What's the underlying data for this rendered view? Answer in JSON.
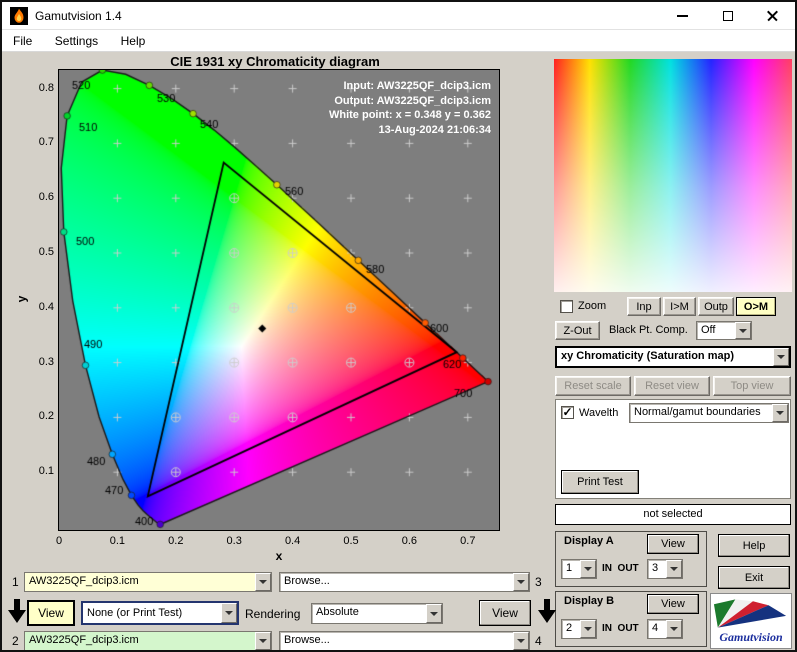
{
  "window": {
    "title": "Gamutvision 1.4",
    "menu": [
      "File",
      "Settings",
      "Help"
    ]
  },
  "icons": {
    "checkmark": "✓"
  },
  "chart": {
    "title": "CIE 1931 xy Chromaticity diagram",
    "xlabel": "x",
    "ylabel": "y",
    "overlay_lines": [
      "Input:  AW3225QF_dcip3.icm",
      "Output: AW3225QF_dcip3.icm",
      "White point:  x = 0.348  y = 0.362",
      "13-Aug-2024 21:06:34"
    ]
  },
  "chart_data": {
    "type": "scatter",
    "title": "CIE 1931 xy Chromaticity diagram",
    "xlabel": "x",
    "ylabel": "y",
    "xlim": [
      0,
      0.7534
    ],
    "ylim": [
      -0.0055,
      0.8339
    ],
    "x_ticks": [
      0,
      0.1,
      0.2,
      0.3,
      0.4,
      0.5,
      0.6,
      0.7
    ],
    "y_ticks": [
      0.1,
      0.2,
      0.3,
      0.4,
      0.5,
      0.6,
      0.7,
      0.8
    ],
    "grid_step": 0.1,
    "plot_background": "#7e7e7e",
    "white_point": {
      "x": 0.348,
      "y": 0.362
    },
    "gamut_triangle": [
      [
        0.681,
        0.319
      ],
      [
        0.282,
        0.665
      ],
      [
        0.152,
        0.056
      ]
    ],
    "spectral_locus": [
      [
        380,
        0.1741,
        0.005
      ],
      [
        390,
        0.1738,
        0.0049
      ],
      [
        400,
        0.1733,
        0.0048
      ],
      [
        410,
        0.1726,
        0.0048
      ],
      [
        420,
        0.1714,
        0.0051
      ],
      [
        430,
        0.1689,
        0.0069
      ],
      [
        435,
        0.1669,
        0.0086
      ],
      [
        440,
        0.1644,
        0.0109
      ],
      [
        445,
        0.1611,
        0.0138
      ],
      [
        450,
        0.1566,
        0.0177
      ],
      [
        455,
        0.151,
        0.0227
      ],
      [
        460,
        0.144,
        0.0297
      ],
      [
        465,
        0.1355,
        0.0399
      ],
      [
        470,
        0.1241,
        0.0578
      ],
      [
        475,
        0.1096,
        0.0868
      ],
      [
        480,
        0.0913,
        0.1327
      ],
      [
        485,
        0.0687,
        0.2007
      ],
      [
        490,
        0.0454,
        0.295
      ],
      [
        495,
        0.0235,
        0.4127
      ],
      [
        500,
        0.0082,
        0.5384
      ],
      [
        505,
        0.0039,
        0.6548
      ],
      [
        510,
        0.0139,
        0.7502
      ],
      [
        515,
        0.0389,
        0.812
      ],
      [
        520,
        0.0743,
        0.8338
      ],
      [
        525,
        0.1142,
        0.8262
      ],
      [
        530,
        0.1547,
        0.8059
      ],
      [
        535,
        0.1929,
        0.7816
      ],
      [
        540,
        0.2296,
        0.7543
      ],
      [
        545,
        0.2658,
        0.7243
      ],
      [
        550,
        0.3016,
        0.6923
      ],
      [
        555,
        0.3373,
        0.6589
      ],
      [
        560,
        0.3731,
        0.6245
      ],
      [
        565,
        0.4087,
        0.5896
      ],
      [
        570,
        0.4441,
        0.5547
      ],
      [
        575,
        0.4788,
        0.5202
      ],
      [
        580,
        0.5125,
        0.4866
      ],
      [
        585,
        0.5448,
        0.4544
      ],
      [
        590,
        0.5752,
        0.4242
      ],
      [
        595,
        0.6029,
        0.3965
      ],
      [
        600,
        0.627,
        0.3725
      ],
      [
        605,
        0.6482,
        0.3514
      ],
      [
        610,
        0.6658,
        0.334
      ],
      [
        615,
        0.6801,
        0.3197
      ],
      [
        620,
        0.6915,
        0.3083
      ],
      [
        630,
        0.7079,
        0.292
      ],
      [
        640,
        0.719,
        0.2809
      ],
      [
        650,
        0.726,
        0.274
      ],
      [
        660,
        0.73,
        0.27
      ],
      [
        680,
        0.7334,
        0.2666
      ],
      [
        700,
        0.7347,
        0.2653
      ]
    ],
    "wavelength_marks": [
      {
        "wl": "520",
        "x": 0.0743,
        "y": 0.8338,
        "color": "#2bd800",
        "lx": 13,
        "ly": 16
      },
      {
        "wl": "530",
        "x": 0.1547,
        "y": 0.8059,
        "color": "#66dc00",
        "lx": 98,
        "ly": 29
      },
      {
        "wl": "510",
        "x": 0.0139,
        "y": 0.7502,
        "color": "#00d42a",
        "lx": 20,
        "ly": 58
      },
      {
        "wl": "540",
        "x": 0.2296,
        "y": 0.7543,
        "color": "#9fe000",
        "lx": 141,
        "ly": 55
      },
      {
        "wl": "560",
        "x": 0.3731,
        "y": 0.6245,
        "color": "#e3d500",
        "lx": 226,
        "ly": 122
      },
      {
        "wl": "500",
        "x": 0.0082,
        "y": 0.5384,
        "color": "#00dd85",
        "lx": 17,
        "ly": 172
      },
      {
        "wl": "580",
        "x": 0.5125,
        "y": 0.4866,
        "color": "#ffa800",
        "lx": 307,
        "ly": 200
      },
      {
        "wl": "490",
        "x": 0.0454,
        "y": 0.295,
        "color": "#00cfd4",
        "lx": 25,
        "ly": 275
      },
      {
        "wl": "600",
        "x": 0.627,
        "y": 0.3725,
        "color": "#ff5a00",
        "lx": 371,
        "ly": 259
      },
      {
        "wl": "620",
        "x": 0.6915,
        "y": 0.3083,
        "color": "#ff2000",
        "lx": 384,
        "ly": 295
      },
      {
        "wl": "700",
        "x": 0.7347,
        "y": 0.2653,
        "color": "#cf0000",
        "lx": 395,
        "ly": 324
      },
      {
        "wl": "480",
        "x": 0.0913,
        "y": 0.1327,
        "color": "#00a6ff",
        "lx": 28,
        "ly": 392
      },
      {
        "wl": "470",
        "x": 0.1241,
        "y": 0.0578,
        "color": "#0048ff",
        "lx": 46,
        "ly": 421
      },
      {
        "wl": "400",
        "x": 0.1733,
        "y": 0.0048,
        "color": "#4a00cc",
        "lx": 76,
        "ly": 452
      }
    ]
  },
  "right_panel": {
    "zoom_label": "Zoom",
    "view_buttons": {
      "inp": "Inp",
      "i_m": "I>M",
      "outp": "Outp",
      "o_m": "O>M"
    },
    "zout_label": "Z-Out",
    "black_pt_label": "Black Pt. Comp.",
    "black_pt_value": "Off",
    "mode_value": "xy Chromaticity (Saturation map)",
    "reset_scale": "Reset scale",
    "reset_view": "Reset view",
    "top_view": "Top view",
    "wavelth_label": "Wavelth",
    "wavelth_value": "Normal/gamut boundaries",
    "print_test": "Print Test",
    "status": "not selected",
    "display_a": {
      "title": "Display A",
      "view": "View",
      "in_value": "1",
      "inout_label": "IN  OUT",
      "out_value": "3"
    },
    "display_b": {
      "title": "Display B",
      "view": "View",
      "in_value": "2",
      "inout_label": "IN  OUT",
      "out_value": "4"
    },
    "help": "Help",
    "exit": "Exit",
    "logo_text": "Gamutvision"
  },
  "bottom": {
    "row1": {
      "num": "1",
      "profile": "AW3225QF_dcip3.icm",
      "browse": "Browse...",
      "num_right": "3"
    },
    "middle": {
      "view_left": "View",
      "intent": "None (or Print Test)",
      "rendering_label": "Rendering",
      "rendering_value": "Absolute",
      "view_right": "View"
    },
    "row2": {
      "num": "2",
      "profile": "AW3225QF_dcip3.icm",
      "browse": "Browse...",
      "num_right": "4"
    }
  }
}
